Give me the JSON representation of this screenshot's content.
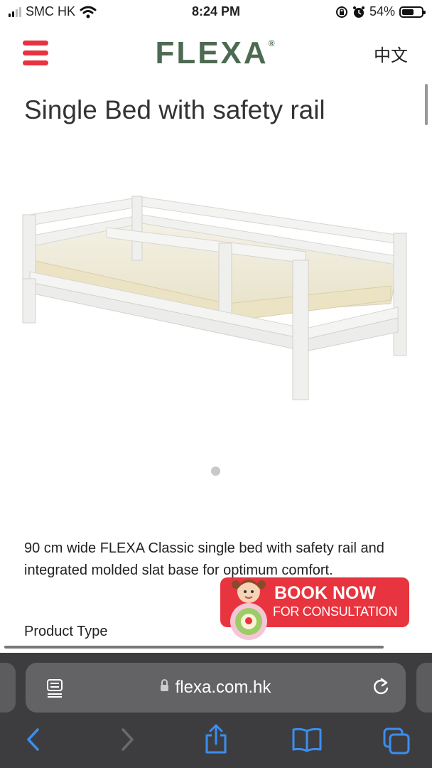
{
  "status_bar": {
    "carrier": "SMC HK",
    "time": "8:24 PM",
    "battery_percent": "54%",
    "battery_level": 0.54
  },
  "header": {
    "logo": "FLEXA",
    "logo_mark": "®",
    "language": "中文",
    "accent_color": "#e8333f",
    "logo_color": "#4d6a52"
  },
  "product": {
    "title": "Single Bed with safety rail",
    "description": "90 cm wide FLEXA Classic single bed with safety rail and integrated molded slat base for optimum comfort.",
    "section_label": "Product Type"
  },
  "promo": {
    "line1": "BOOK NOW",
    "line2": "FOR CONSULTATION",
    "color": "#e8343e"
  },
  "browser": {
    "url": "flexa.com.hk",
    "icons": [
      "reader-icon",
      "lock-icon",
      "reload-icon",
      "back-icon",
      "forward-icon",
      "share-icon",
      "bookmarks-icon",
      "tabs-icon"
    ]
  }
}
